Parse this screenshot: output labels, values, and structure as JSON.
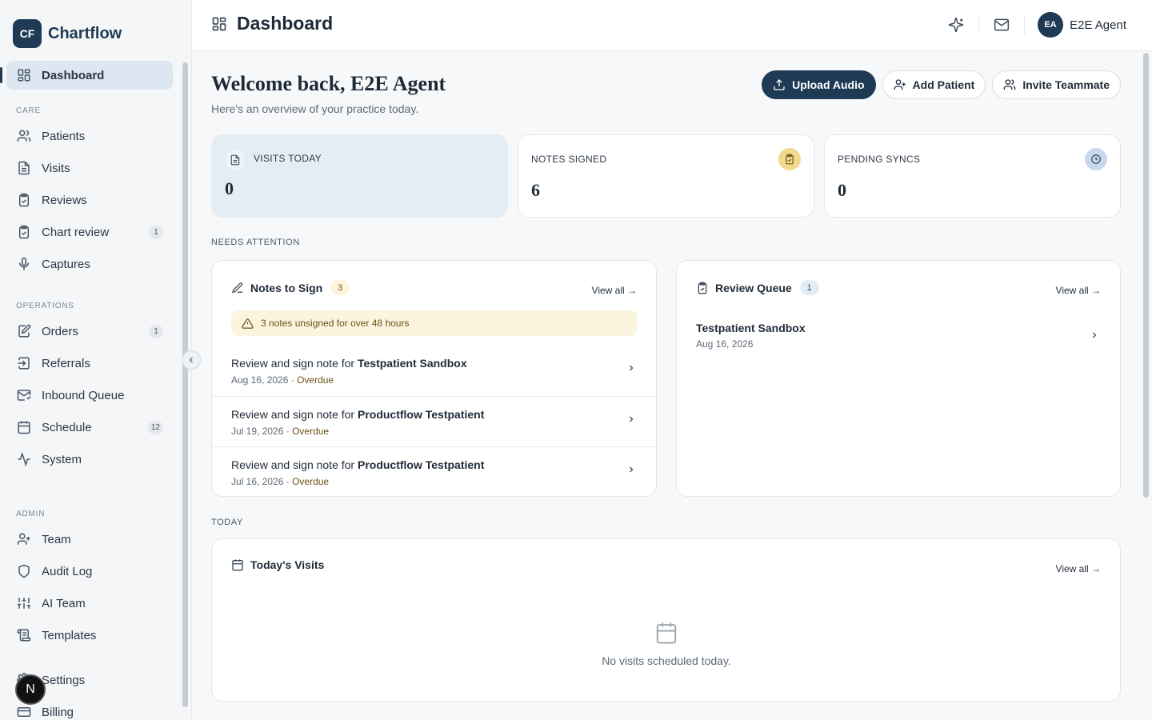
{
  "brand": {
    "logo": "CF",
    "name": "Chartflow"
  },
  "sidebar": {
    "dashboard": {
      "label": "Dashboard",
      "icon": "grid-icon"
    },
    "care_label": "CARE",
    "care": [
      {
        "label": "Patients",
        "icon": "users-icon",
        "badge": ""
      },
      {
        "label": "Visits",
        "icon": "file-text-icon",
        "badge": ""
      },
      {
        "label": "Reviews",
        "icon": "clipboard-check-icon",
        "badge": ""
      },
      {
        "label": "Chart review",
        "icon": "clipboard-check-icon",
        "badge": "1"
      },
      {
        "label": "Captures",
        "icon": "microphone-icon",
        "badge": ""
      }
    ],
    "operations_label": "OPERATIONS",
    "operations": [
      {
        "label": "Orders",
        "icon": "edit-document-icon",
        "badge": "1"
      },
      {
        "label": "Referrals",
        "icon": "arrow-in-icon",
        "badge": ""
      },
      {
        "label": "Inbound Queue",
        "icon": "mail-icon",
        "badge": ""
      },
      {
        "label": "Schedule",
        "icon": "calendar-icon",
        "badge": "12"
      },
      {
        "label": "System",
        "icon": "activity-icon",
        "badge": ""
      }
    ],
    "admin_label": "ADMIN",
    "admin": [
      {
        "label": "Team",
        "icon": "user-plus-icon",
        "badge": ""
      },
      {
        "label": "Audit Log",
        "icon": "shield-icon",
        "badge": ""
      },
      {
        "label": "AI Team",
        "icon": "sliders-icon",
        "badge": ""
      },
      {
        "label": "Templates",
        "icon": "scroll-icon",
        "badge": ""
      },
      {
        "label": "Settings",
        "icon": "gear-icon",
        "badge": ""
      },
      {
        "label": "Billing",
        "icon": "card-icon",
        "badge": ""
      }
    ],
    "overlay_badge": "N"
  },
  "header": {
    "title": "Dashboard",
    "user_initials": "EA",
    "user_name": "E2E Agent"
  },
  "welcome": {
    "title": "Welcome back, E2E Agent",
    "subtitle": "Here's an overview of your practice today."
  },
  "actions": {
    "upload": "Upload Audio",
    "add_patient": "Add Patient",
    "invite": "Invite Teammate"
  },
  "stats": {
    "visits_today": {
      "label": "VISITS TODAY",
      "value": "0"
    },
    "notes_signed": {
      "label": "NOTES SIGNED",
      "value": "6",
      "icon_color": "#f3d98c"
    },
    "pending_syncs": {
      "label": "PENDING SYNCS",
      "value": "0",
      "icon_color": "#c9d7ea"
    }
  },
  "needs_attention_label": "NEEDS ATTENTION",
  "notes_to_sign": {
    "title": "Notes to Sign",
    "count": "3",
    "view_all": "View all →",
    "warning": "3 notes unsigned for over 48 hours",
    "rows": [
      {
        "prefix": "Review and sign note for ",
        "patient": "Testpatient Sandbox",
        "date": "Aug 16, 2026",
        "status": "Overdue"
      },
      {
        "prefix": "Review and sign note for ",
        "patient": "Productflow Testpatient",
        "date": "Jul 19, 2026",
        "status": "Overdue"
      },
      {
        "prefix": "Review and sign note for ",
        "patient": "Productflow Testpatient",
        "date": "Jul 16, 2026",
        "status": "Overdue"
      }
    ]
  },
  "review_queue": {
    "title": "Review Queue",
    "count": "1",
    "view_all": "View all →",
    "item": {
      "name": "Testpatient Sandbox",
      "date": "Aug 16, 2026"
    }
  },
  "today_label": "TODAY",
  "todays_visits": {
    "title": "Today's Visits",
    "view_all": "View all →",
    "empty": "No visits scheduled today."
  },
  "colors": {
    "brand": "#1e3a55",
    "warning_bg": "#fbf4df",
    "highlight": "#e5edf4"
  }
}
